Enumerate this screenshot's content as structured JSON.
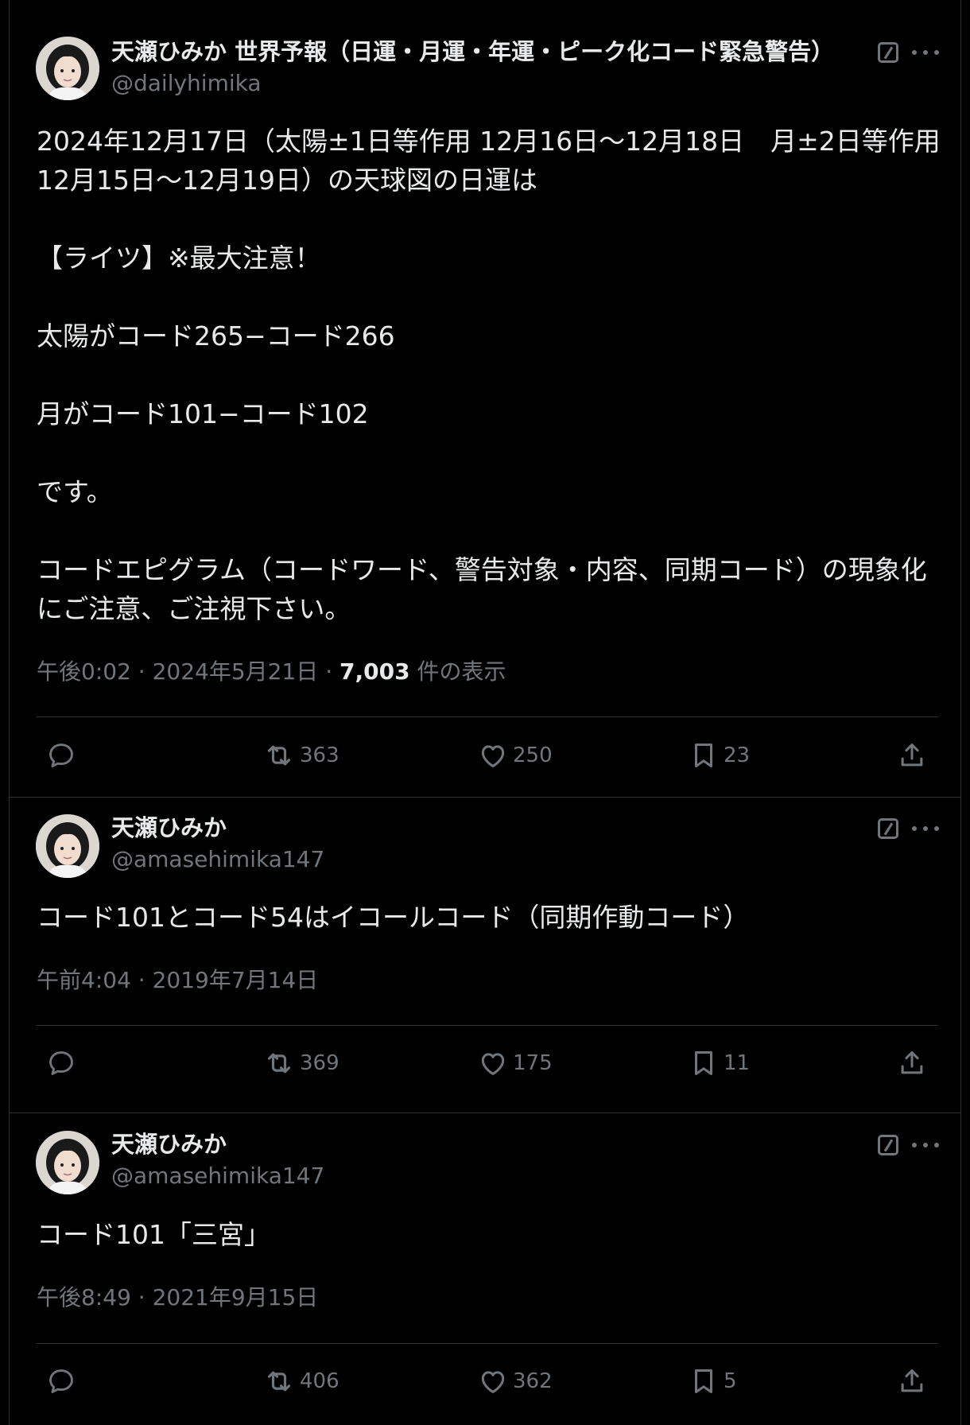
{
  "posts": [
    {
      "name": "天瀬ひみか 世界予報（日運・月運・年運・ピーク化コード緊急警告）",
      "handle": "@dailyhimika",
      "text": "2024年12月17日（太陽±1日等作用 12月16日〜12月18日　月±2日等作用 12月15日〜12月19日）の天球図の日運は\n\n【ライツ】※最大注意！\n\n太陽がコード265−コード266\n\n月がコード101−コード102\n\nです。\n\nコードエピグラム（コードワード、警告対象・内容、同期コード）の現象化にご注意、ご注視下さい。",
      "time": "午後0:02",
      "date": "2024年5月21日",
      "views": "7,003",
      "views_label": "件の表示",
      "reposts": "363",
      "likes": "250",
      "bookmarks": "23"
    },
    {
      "name": "天瀬ひみか",
      "handle": "@amasehimika147",
      "text": "コード101とコード54はイコールコード（同期作動コード）",
      "time": "午前4:04",
      "date": "2019年7月14日",
      "reposts": "369",
      "likes": "175",
      "bookmarks": "11"
    },
    {
      "name": "天瀬ひみか",
      "handle": "@amasehimika147",
      "text": "コード101「三宮」",
      "time": "午後8:49",
      "date": "2021年9月15日",
      "reposts": "406",
      "likes": "362",
      "bookmarks": "5"
    }
  ],
  "colors": {
    "background": "#000000",
    "text": "#e7e9ea",
    "secondary": "#71767b",
    "divider": "#2f3336"
  },
  "icons": [
    "reply-icon",
    "repost-icon",
    "like-icon",
    "bookmark-icon",
    "share-icon",
    "grok-icon",
    "more-icon"
  ]
}
